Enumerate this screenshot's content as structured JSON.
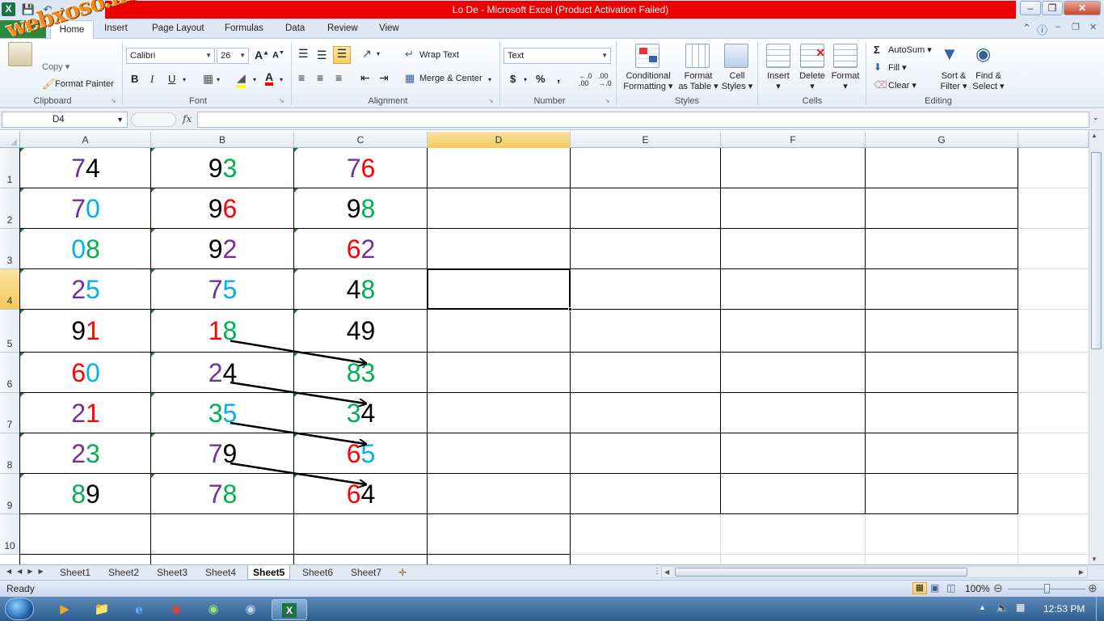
{
  "title": "Lo De  -  Microsoft Excel (Product Activation Failed)",
  "watermark": "webxoso.net",
  "tabs": {
    "file": "File",
    "home": "Home",
    "insert": "Insert",
    "page_layout": "Page Layout",
    "formulas": "Formulas",
    "data": "Data",
    "review": "Review",
    "view": "View"
  },
  "clipboard": {
    "copy": "Copy",
    "format_painter": "Format Painter",
    "label": "Clipboard"
  },
  "font": {
    "name": "Calibri",
    "size": "26",
    "label": "Font",
    "bold": "B",
    "italic": "I",
    "underline": "U"
  },
  "alignment": {
    "wrap_text": "Wrap Text",
    "merge_center": "Merge & Center",
    "label": "Alignment"
  },
  "number": {
    "format": "Text",
    "label": "Number",
    "currency": "$",
    "percent": "%",
    "comma": ","
  },
  "styles": {
    "conditional": "Conditional",
    "conditional2": "Formatting",
    "format_as": "Format",
    "format_as2": "as Table",
    "cell": "Cell",
    "cell2": "Styles",
    "label": "Styles"
  },
  "cells": {
    "insert": "Insert",
    "delete": "Delete",
    "format": "Format",
    "label": "Cells"
  },
  "editing": {
    "autosum": "AutoSum",
    "fill": "Fill",
    "clear": "Clear",
    "sort": "Sort &",
    "sort2": "Filter",
    "find": "Find &",
    "find2": "Select",
    "label": "Editing"
  },
  "formula_bar": {
    "name_box": "D4",
    "fx": "fx",
    "value": ""
  },
  "columns": [
    "A",
    "B",
    "C",
    "D",
    "E",
    "F",
    "G"
  ],
  "rows": [
    "1",
    "2",
    "3",
    "4",
    "5",
    "6",
    "7",
    "8",
    "9",
    "10"
  ],
  "colors": {
    "purple": "#7030a0",
    "black": "#000000",
    "green": "#00b050",
    "red": "#ff0000",
    "blue": "#00b0f0"
  },
  "cells_data": {
    "A1": {
      "d1": "7",
      "c1": "purple",
      "d2": "4",
      "c2": "black"
    },
    "B1": {
      "d1": "9",
      "c1": "black",
      "d2": "3",
      "c2": "green"
    },
    "C1": {
      "d1": "7",
      "c1": "purple",
      "d2": "6",
      "c2": "red"
    },
    "A2": {
      "d1": "7",
      "c1": "purple",
      "d2": "0",
      "c2": "blue"
    },
    "B2": {
      "d1": "9",
      "c1": "black",
      "d2": "6",
      "c2": "red"
    },
    "C2": {
      "d1": "9",
      "c1": "black",
      "d2": "8",
      "c2": "green"
    },
    "A3": {
      "d1": "0",
      "c1": "blue",
      "d2": "8",
      "c2": "green"
    },
    "B3": {
      "d1": "9",
      "c1": "black",
      "d2": "2",
      "c2": "purple"
    },
    "C3": {
      "d1": "6",
      "c1": "red",
      "d2": "2",
      "c2": "purple"
    },
    "A4": {
      "d1": "2",
      "c1": "purple",
      "d2": "5",
      "c2": "blue"
    },
    "B4": {
      "d1": "7",
      "c1": "purple",
      "d2": "5",
      "c2": "blue"
    },
    "C4": {
      "d1": "4",
      "c1": "black",
      "d2": "8",
      "c2": "green"
    },
    "A5": {
      "d1": "9",
      "c1": "black",
      "d2": "1",
      "c2": "red"
    },
    "B5": {
      "d1": "1",
      "c1": "red",
      "d2": "8",
      "c2": "green"
    },
    "C5": {
      "d1": "4",
      "c1": "black",
      "d2": "9",
      "c2": "black"
    },
    "A6": {
      "d1": "6",
      "c1": "red",
      "d2": "0",
      "c2": "blue"
    },
    "B6": {
      "d1": "2",
      "c1": "purple",
      "d2": "4",
      "c2": "black"
    },
    "C6": {
      "d1": "8",
      "c1": "green",
      "d2": "3",
      "c2": "green"
    },
    "A7": {
      "d1": "2",
      "c1": "purple",
      "d2": "1",
      "c2": "red"
    },
    "B7": {
      "d1": "3",
      "c1": "green",
      "d2": "5",
      "c2": "blue"
    },
    "C7": {
      "d1": "3",
      "c1": "green",
      "d2": "4",
      "c2": "black"
    },
    "A8": {
      "d1": "2",
      "c1": "purple",
      "d2": "3",
      "c2": "green"
    },
    "B8": {
      "d1": "7",
      "c1": "purple",
      "d2": "9",
      "c2": "black"
    },
    "C8": {
      "d1": "6",
      "c1": "red",
      "d2": "5",
      "c2": "blue"
    },
    "A9": {
      "d1": "8",
      "c1": "green",
      "d2": "9",
      "c2": "black"
    },
    "B9": {
      "d1": "7",
      "c1": "purple",
      "d2": "8",
      "c2": "green"
    },
    "C9": {
      "d1": "6",
      "c1": "red",
      "d2": "4",
      "c2": "black"
    }
  },
  "arrows": [
    {
      "from": "B5",
      "to": "C6"
    },
    {
      "from": "B6",
      "to": "C7"
    },
    {
      "from": "B7",
      "to": "C8"
    },
    {
      "from": "B8",
      "to": "C9"
    }
  ],
  "sheets": [
    "Sheet1",
    "Sheet2",
    "Sheet3",
    "Sheet4",
    "Sheet5",
    "Sheet6",
    "Sheet7"
  ],
  "active_sheet": "Sheet5",
  "status": {
    "ready": "Ready",
    "zoom": "100%"
  },
  "taskbar": {
    "time": "12:53 PM"
  }
}
